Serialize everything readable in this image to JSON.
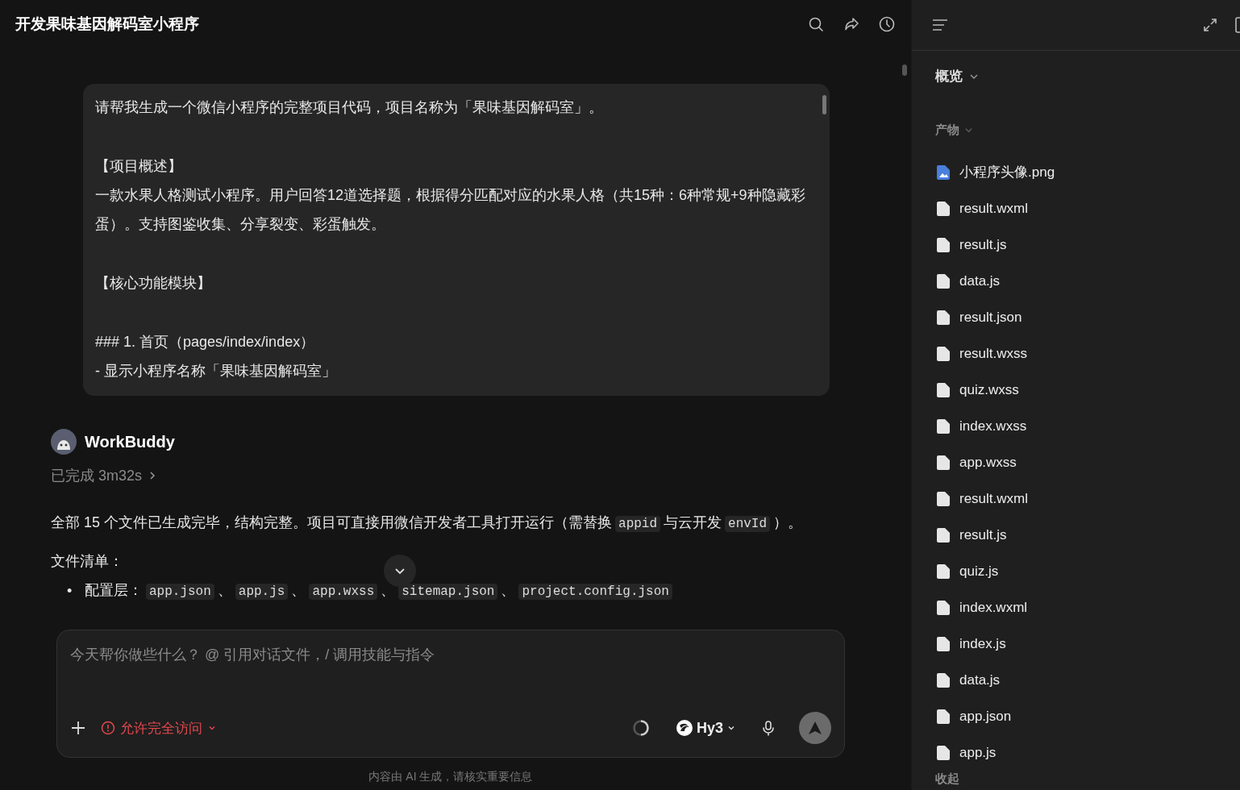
{
  "title": "开发果味基因解码室小程序",
  "user_message": {
    "paragraphs": [
      [
        "请帮我生成一个微信小程序的完整项目代码，项目名称为「果味基因解码室」。"
      ],
      [
        "【项目概述】",
        "一款水果人格测试小程序。用户回答12道选择题，根据得分匹配对应的水果人格（共15种：6种常规+9种隐藏彩蛋）。支持图鉴收集、分享裂变、彩蛋触发。"
      ],
      [
        "【核心功能模块】"
      ],
      [
        "### 1. 首页（pages/index/index）",
        "- 显示小程序名称「果味基因解码室」"
      ]
    ]
  },
  "assistant": {
    "name": "WorkBuddy",
    "status": "已完成 3m32s",
    "summary": [
      {
        "kind": "text",
        "text": "全部 15 个文件已生成完毕，结构完整。项目可直接用微信开发者工具打开运行（需替换"
      },
      {
        "kind": "code",
        "text": "appid"
      },
      {
        "kind": "text",
        "text": "与云开发"
      },
      {
        "kind": "code",
        "text": "envId"
      },
      {
        "kind": "text",
        "text": "）。"
      }
    ],
    "list_title": "文件清单：",
    "separator": "、",
    "bullets": [
      {
        "marker": "•",
        "label": "配置层：",
        "files": [
          "app.json",
          "app.js",
          "app.wxss",
          "sitemap.json",
          "project.config.json"
        ]
      }
    ]
  },
  "composer": {
    "placeholder": "今天帮你做些什么？ @ 引用对话文件，/ 调用技能与指令",
    "access": "允许完全访问",
    "model": "Hy3"
  },
  "footer": "内容由 AI 生成，请核实重要信息",
  "side": {
    "overview": "概览",
    "section": "产物",
    "collapse": "收起",
    "files": [
      {
        "name": "小程序头像.png",
        "kind": "image"
      },
      {
        "name": "result.wxml",
        "kind": "file"
      },
      {
        "name": "result.js",
        "kind": "file"
      },
      {
        "name": "data.js",
        "kind": "file"
      },
      {
        "name": "result.json",
        "kind": "file"
      },
      {
        "name": "result.wxss",
        "kind": "file"
      },
      {
        "name": "quiz.wxss",
        "kind": "file"
      },
      {
        "name": "index.wxss",
        "kind": "file"
      },
      {
        "name": "app.wxss",
        "kind": "file"
      },
      {
        "name": "result.wxml",
        "kind": "file"
      },
      {
        "name": "result.js",
        "kind": "file"
      },
      {
        "name": "quiz.js",
        "kind": "file"
      },
      {
        "name": "index.wxml",
        "kind": "file"
      },
      {
        "name": "index.js",
        "kind": "file"
      },
      {
        "name": "data.js",
        "kind": "file"
      },
      {
        "name": "app.json",
        "kind": "file"
      },
      {
        "name": "app.js",
        "kind": "file"
      }
    ]
  }
}
